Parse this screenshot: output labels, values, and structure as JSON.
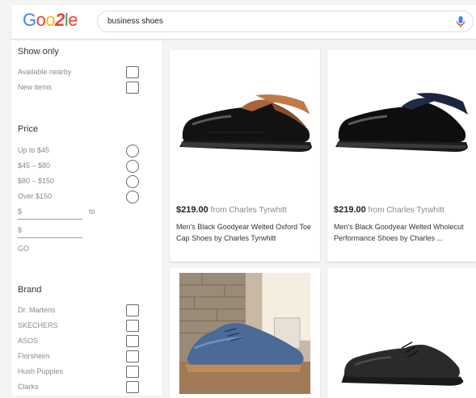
{
  "header": {
    "logo": "Google",
    "search_value": "business shoes"
  },
  "filters": {
    "show_only": {
      "title": "Show only",
      "options": [
        "Available nearby",
        "New items"
      ]
    },
    "price": {
      "title": "Price",
      "options": [
        "Up to $45",
        "$45 – $80",
        "$80 – $150",
        "Over $150"
      ],
      "min_prefix": "$",
      "max_prefix": "$",
      "to_label": "to",
      "go_label": "GO"
    },
    "brand": {
      "title": "Brand",
      "options": [
        "Dr. Martens",
        "SKECHERS",
        "ASOS",
        "Florsheim",
        "Hush Puppies",
        "Clarks"
      ]
    }
  },
  "products": [
    {
      "price": "$219.00",
      "seller": "from Charles Tyrwhitt",
      "title": "Men's Black Goodyear Welted Oxford Toe Cap Shoes by Charles Tyrwhitt",
      "image": "black-oxford-shoe"
    },
    {
      "price": "$219.00",
      "seller": "from Charles Tyrwhitt",
      "title": "Men's Black Goodyear Welted Wholecut Performance Shoes by Charles ...",
      "image": "black-wholecut-shoe"
    },
    {
      "price": "",
      "seller": "",
      "title": "",
      "image": "blue-suede-shoe"
    },
    {
      "price": "",
      "seller": "",
      "title": "",
      "image": "black-derby-shoe"
    }
  ],
  "colors": {
    "accent_blue": "#4285f4",
    "accent_red": "#ea4335",
    "accent_yellow": "#fbbc05",
    "accent_green": "#34a853"
  }
}
